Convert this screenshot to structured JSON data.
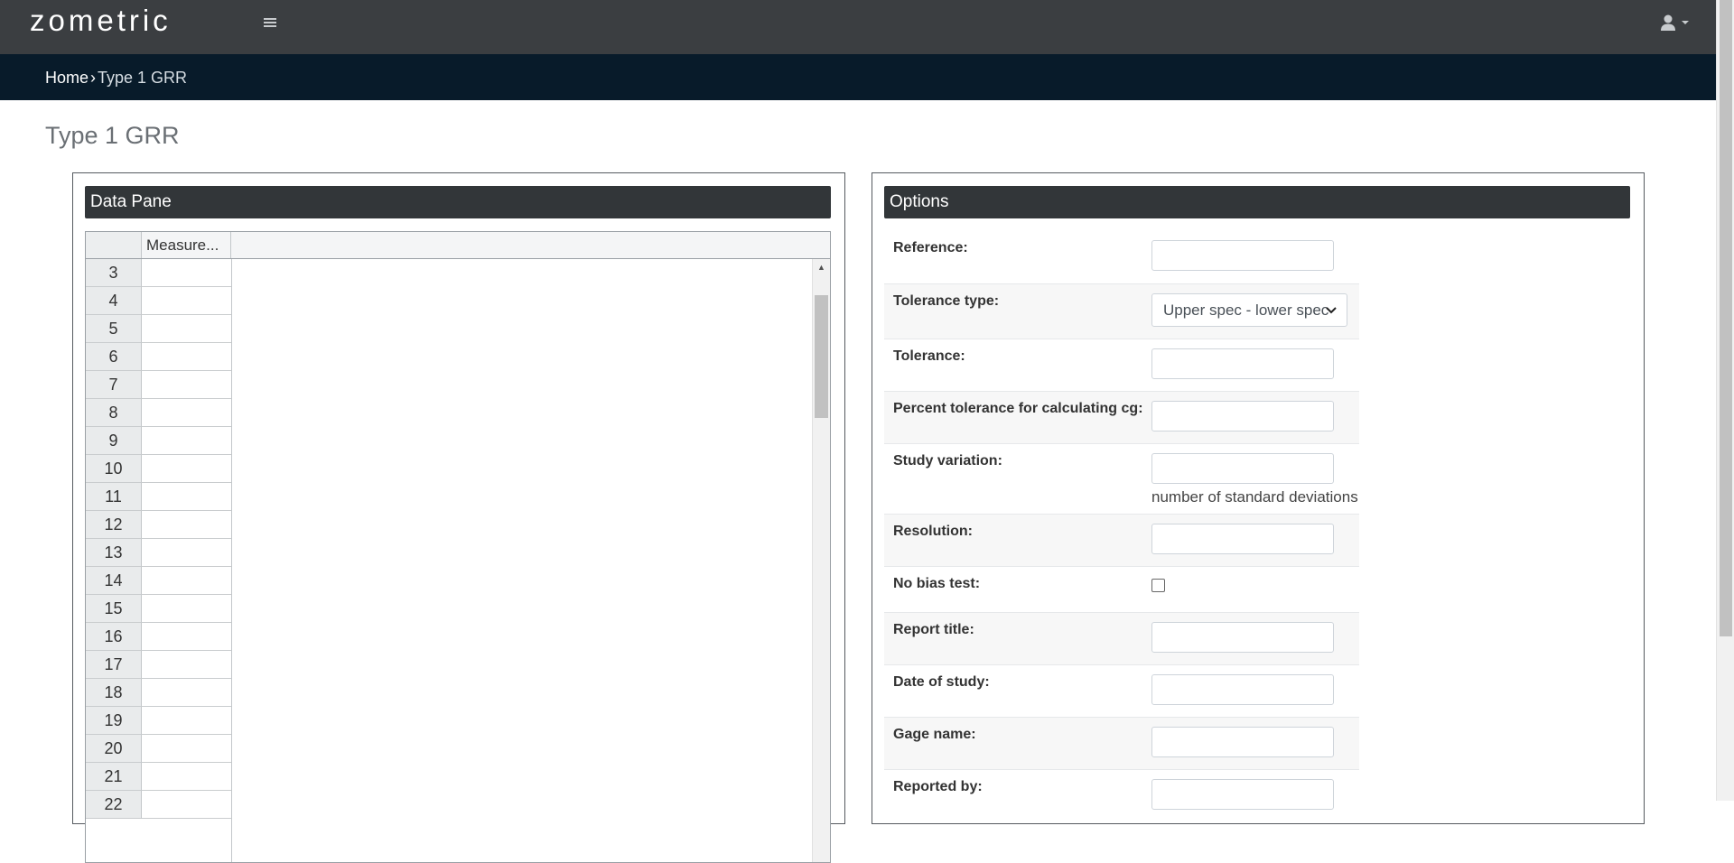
{
  "app": {
    "logo_text": "zometric"
  },
  "breadcrumb": {
    "home": "Home",
    "separator": "›",
    "current": "Type 1 GRR"
  },
  "page": {
    "title": "Type 1 GRR"
  },
  "data_pane": {
    "title": "Data Pane",
    "column_header": "Measure...",
    "rows": [
      "3",
      "4",
      "5",
      "6",
      "7",
      "8",
      "9",
      "10",
      "11",
      "12",
      "13",
      "14",
      "15",
      "16",
      "17",
      "18",
      "19",
      "20",
      "21",
      "22"
    ]
  },
  "options": {
    "title": "Options",
    "reference_label": "Reference:",
    "tolerance_type_label": "Tolerance type:",
    "tolerance_type_value": "Upper spec - lower spec",
    "tolerance_label": "Tolerance:",
    "percent_tolerance_label": "Percent tolerance for calculating cg:",
    "study_variation_label": "Study variation:",
    "study_variation_hint": "number of standard deviations",
    "resolution_label": "Resolution:",
    "no_bias_label": "No bias test:",
    "report_title_label": "Report title:",
    "date_of_study_label": "Date of study:",
    "gage_name_label": "Gage name:",
    "reported_by_label": "Reported by:"
  },
  "colors": {
    "topbar": "#3b3e41",
    "breadbar": "#081b2a",
    "panel_header": "#323639"
  },
  "icons": {
    "menu": "hamburger-icon",
    "user": "user-icon",
    "caret": "caret-down-icon"
  }
}
